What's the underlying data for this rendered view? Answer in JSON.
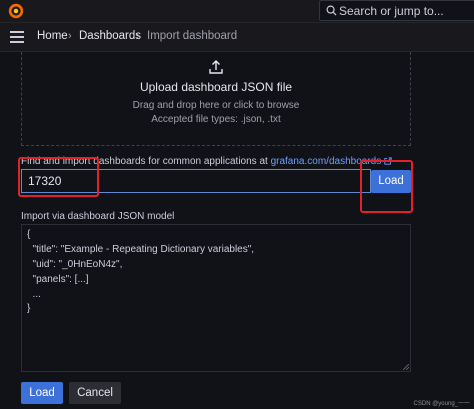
{
  "search": {
    "placeholder": "Search or jump to..."
  },
  "breadcrumb": {
    "home": "Home",
    "dashboards": "Dashboards",
    "current": "Import dashboard"
  },
  "upload": {
    "title": "Upload dashboard JSON file",
    "hint": "Drag and drop here or click to browse",
    "types": "Accepted file types: .json, .txt"
  },
  "find": {
    "label": "Find and import dashboards for common applications at ",
    "link": "grafana.com/dashboards",
    "input_value": "17320",
    "load_label": "Load"
  },
  "json_model": {
    "label": "Import via dashboard JSON model",
    "lines": [
      "{",
      "  \"title\": \"Example - Repeating Dictionary variables\",",
      "  \"uid\": \"_0HnEoN4z\",",
      "  \"panels\": [...]",
      "  ...",
      "}"
    ]
  },
  "actions": {
    "load": "Load",
    "cancel": "Cancel"
  },
  "watermark": "CSDN @young_一一",
  "colors": {
    "accent": "#3d71d9",
    "link": "#6e9fff",
    "highlight": "#e0232b",
    "background": "#111217"
  },
  "icons": [
    "grafana-logo-icon",
    "search-icon",
    "hamburger-icon",
    "upload-icon",
    "external-link-icon"
  ]
}
